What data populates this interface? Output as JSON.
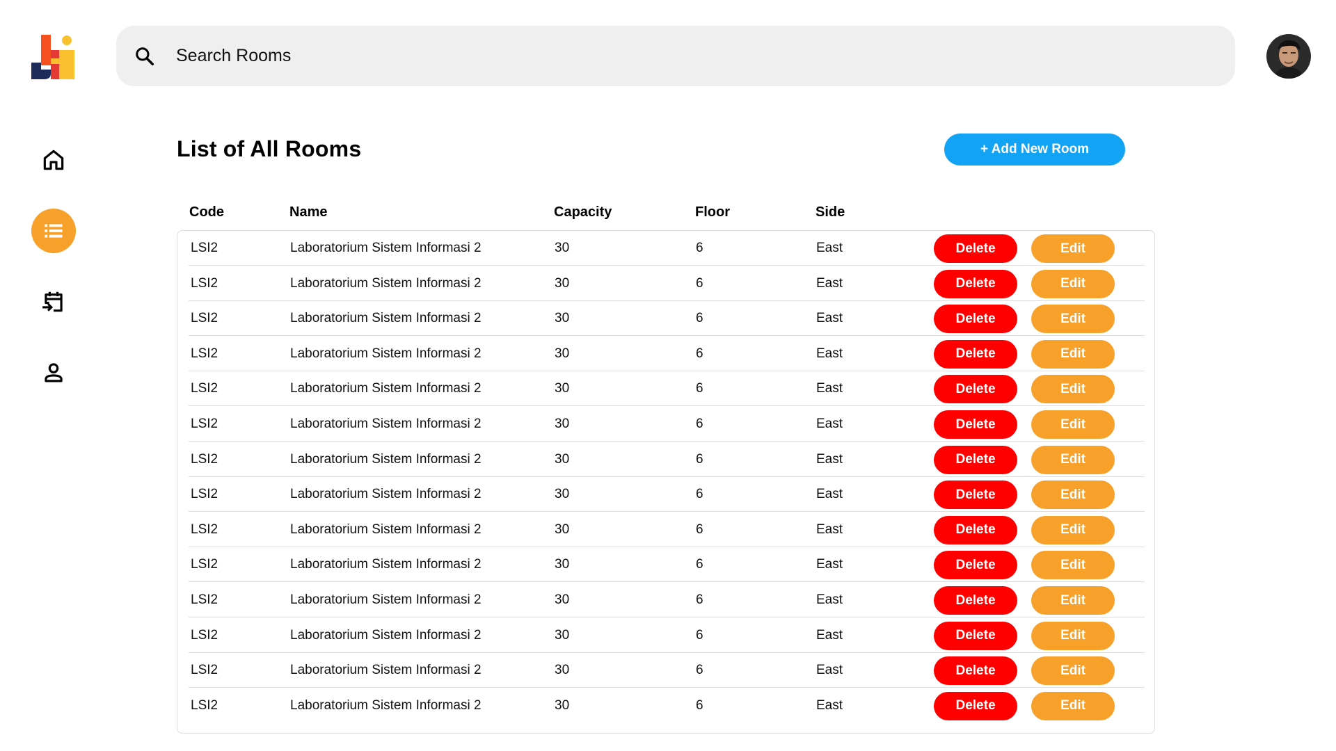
{
  "search": {
    "placeholder": "Search Rooms"
  },
  "colors": {
    "accent": "#F7A12A",
    "primary": "#13A3F4",
    "danger": "#FF0000"
  },
  "sidebar": {
    "items": [
      {
        "name": "home",
        "icon": "home-icon",
        "active": false
      },
      {
        "name": "rooms",
        "icon": "list-icon",
        "active": true
      },
      {
        "name": "bookings",
        "icon": "calendar-arrow-icon",
        "active": false
      },
      {
        "name": "profile",
        "icon": "user-icon",
        "active": false
      }
    ]
  },
  "main": {
    "title": "List of All Rooms",
    "add_button_label": "+ Add New Room",
    "columns": [
      "Code",
      "Name",
      "Capacity",
      "Floor",
      "Side"
    ],
    "delete_label": "Delete",
    "edit_label": "Edit",
    "rows": [
      {
        "code": "LSI2",
        "name": "Laboratorium Sistem Informasi 2",
        "capacity": "30",
        "floor": "6",
        "side": "East"
      },
      {
        "code": "LSI2",
        "name": "Laboratorium Sistem Informasi 2",
        "capacity": "30",
        "floor": "6",
        "side": "East"
      },
      {
        "code": "LSI2",
        "name": "Laboratorium Sistem Informasi 2",
        "capacity": "30",
        "floor": "6",
        "side": "East"
      },
      {
        "code": "LSI2",
        "name": "Laboratorium Sistem Informasi 2",
        "capacity": "30",
        "floor": "6",
        "side": "East"
      },
      {
        "code": "LSI2",
        "name": "Laboratorium Sistem Informasi 2",
        "capacity": "30",
        "floor": "6",
        "side": "East"
      },
      {
        "code": "LSI2",
        "name": "Laboratorium Sistem Informasi 2",
        "capacity": "30",
        "floor": "6",
        "side": "East"
      },
      {
        "code": "LSI2",
        "name": "Laboratorium Sistem Informasi 2",
        "capacity": "30",
        "floor": "6",
        "side": "East"
      },
      {
        "code": "LSI2",
        "name": "Laboratorium Sistem Informasi 2",
        "capacity": "30",
        "floor": "6",
        "side": "East"
      },
      {
        "code": "LSI2",
        "name": "Laboratorium Sistem Informasi 2",
        "capacity": "30",
        "floor": "6",
        "side": "East"
      },
      {
        "code": "LSI2",
        "name": "Laboratorium Sistem Informasi 2",
        "capacity": "30",
        "floor": "6",
        "side": "East"
      },
      {
        "code": "LSI2",
        "name": "Laboratorium Sistem Informasi 2",
        "capacity": "30",
        "floor": "6",
        "side": "East"
      },
      {
        "code": "LSI2",
        "name": "Laboratorium Sistem Informasi 2",
        "capacity": "30",
        "floor": "6",
        "side": "East"
      },
      {
        "code": "LSI2",
        "name": "Laboratorium Sistem Informasi 2",
        "capacity": "30",
        "floor": "6",
        "side": "East"
      },
      {
        "code": "LSI2",
        "name": "Laboratorium Sistem Informasi 2",
        "capacity": "30",
        "floor": "6",
        "side": "East"
      }
    ]
  }
}
